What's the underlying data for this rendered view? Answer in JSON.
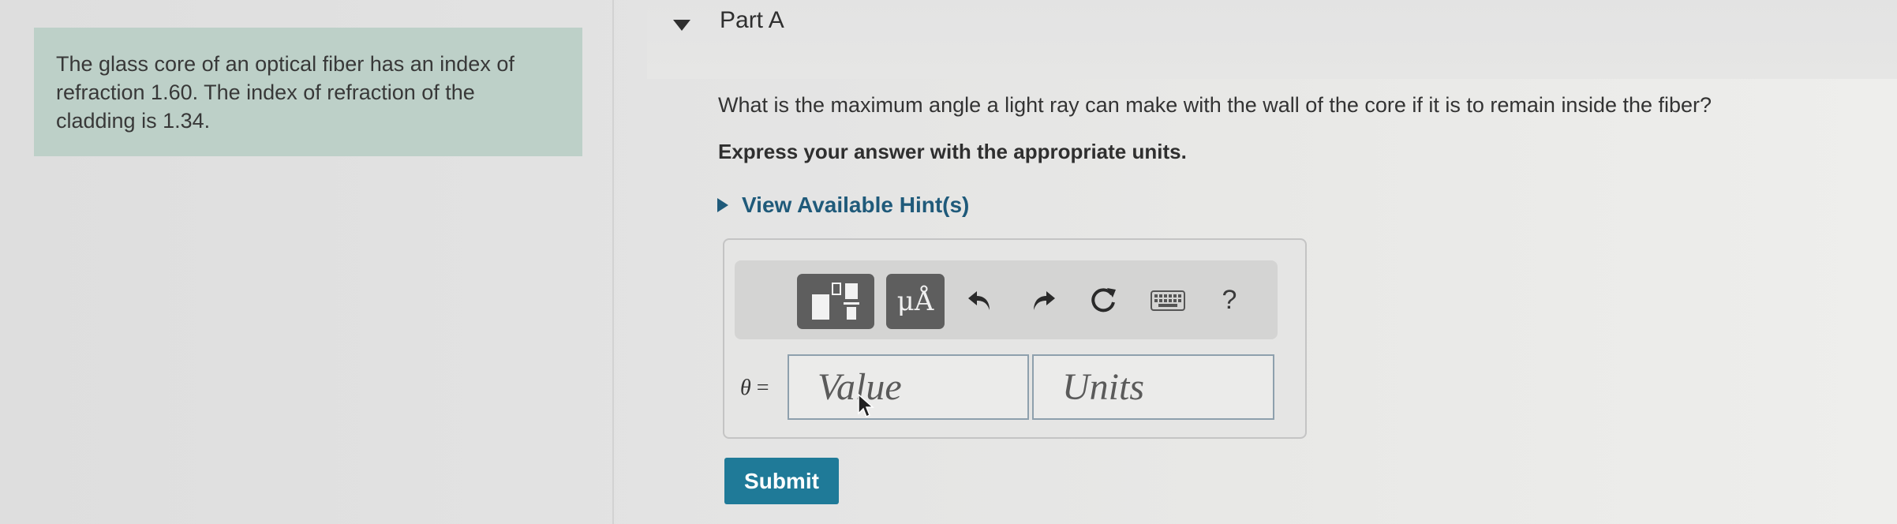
{
  "problem": {
    "text_line1": "The glass core of an optical fiber has an index of",
    "text_line2": "refraction 1.60. The index of refraction of the",
    "text_line3": "cladding is 1.34."
  },
  "part": {
    "title": "Part A",
    "question": "What is the maximum angle a light ray can make with the wall of the core if it is to remain inside the fiber?",
    "instruction": "Express your answer with the appropriate units.",
    "hints_label": "View Available Hint(s)"
  },
  "toolbar": {
    "units_button_label": "μÅ",
    "help_label": "?"
  },
  "answer": {
    "variable": "θ",
    "equals": "=",
    "value_placeholder": "Value",
    "units_placeholder": "Units"
  },
  "submit_label": "Submit",
  "colors": {
    "problem_bg": "#bdd0c8",
    "link": "#1f5a7a",
    "submit_bg": "#1f7a98"
  }
}
